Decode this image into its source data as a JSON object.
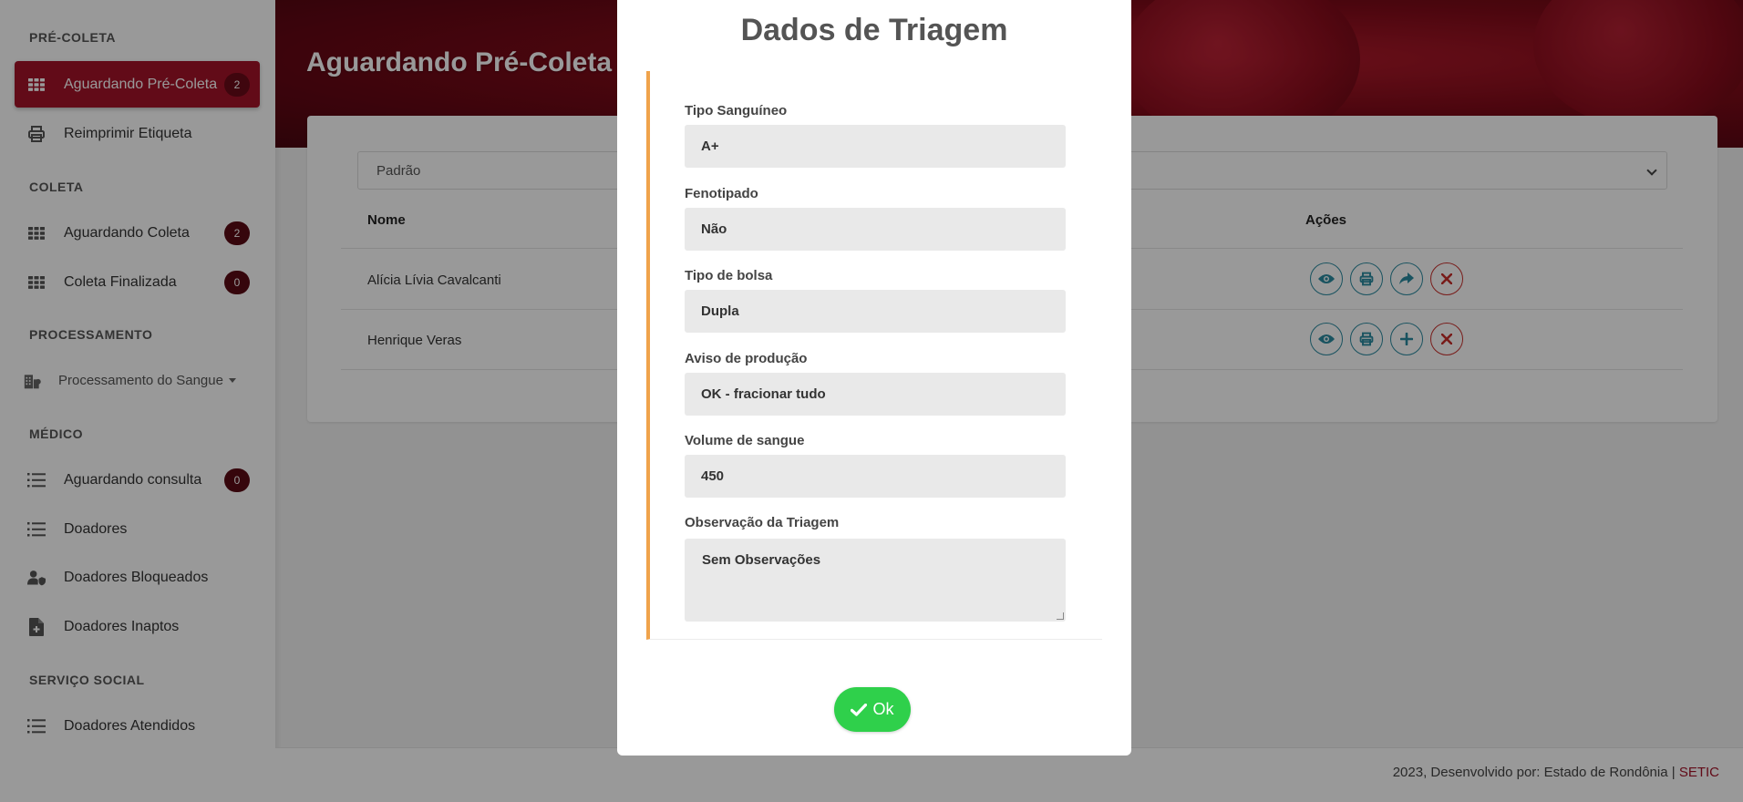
{
  "sidebar": {
    "sections": [
      {
        "title": "PRÉ-COLETA"
      },
      {
        "title": "COLETA"
      },
      {
        "title": "PROCESSAMENTO"
      },
      {
        "title": "MÉDICO"
      },
      {
        "title": "SERVIÇO SOCIAL"
      }
    ],
    "items": [
      {
        "label": "Aguardando Pré-Coleta",
        "badge": "2",
        "icon": "grid-icon"
      },
      {
        "label": "Reimprimir Etiqueta",
        "icon": "printer-icon"
      },
      {
        "label": "Aguardando Coleta",
        "badge": "2",
        "icon": "grid-icon"
      },
      {
        "label": "Coleta Finalizada",
        "badge": "0",
        "icon": "grid-icon"
      },
      {
        "label": "Processamento do Sangue",
        "icon": "building-icon"
      },
      {
        "label": "Aguardando consulta",
        "badge": "0",
        "icon": "list-icon"
      },
      {
        "label": "Doadores",
        "icon": "list-icon"
      },
      {
        "label": "Doadores Bloqueados",
        "icon": "user-shield-icon"
      },
      {
        "label": "Doadores Inaptos",
        "icon": "file-medical-icon"
      },
      {
        "label": "Doadores Atendidos",
        "icon": "list-icon"
      }
    ]
  },
  "main": {
    "title": "Aguardando Pré-Coleta",
    "filter_value": "Padrão",
    "columns": {
      "name": "Nome",
      "actions": "Ações"
    },
    "rows": [
      {
        "name": "Alícia Lívia Cavalcanti"
      },
      {
        "name": "Henrique Veras"
      }
    ]
  },
  "footer": {
    "text": "2023, Desenvolvido por: Estado de Rondônia | ",
    "link": "SETIC"
  },
  "modal": {
    "title": "Dados de Triagem",
    "fields": [
      {
        "label": "Tipo Sanguíneo",
        "value": "A+"
      },
      {
        "label": "Fenotipado",
        "value": "Não"
      },
      {
        "label": "Tipo de bolsa",
        "value": "Dupla"
      },
      {
        "label": "Aviso de produção",
        "value": "OK - fracionar tudo"
      },
      {
        "label": "Volume de sangue",
        "value": "450"
      },
      {
        "label": "Observação da Triagem",
        "value": "Sem Observações"
      }
    ],
    "ok_label": "Ok"
  },
  "colors": {
    "brand": "#a31329",
    "accent_border": "#f0a34b",
    "ok_button": "#2fd04b",
    "action_icon": "#2b8aa0",
    "danger": "#c9302c"
  }
}
